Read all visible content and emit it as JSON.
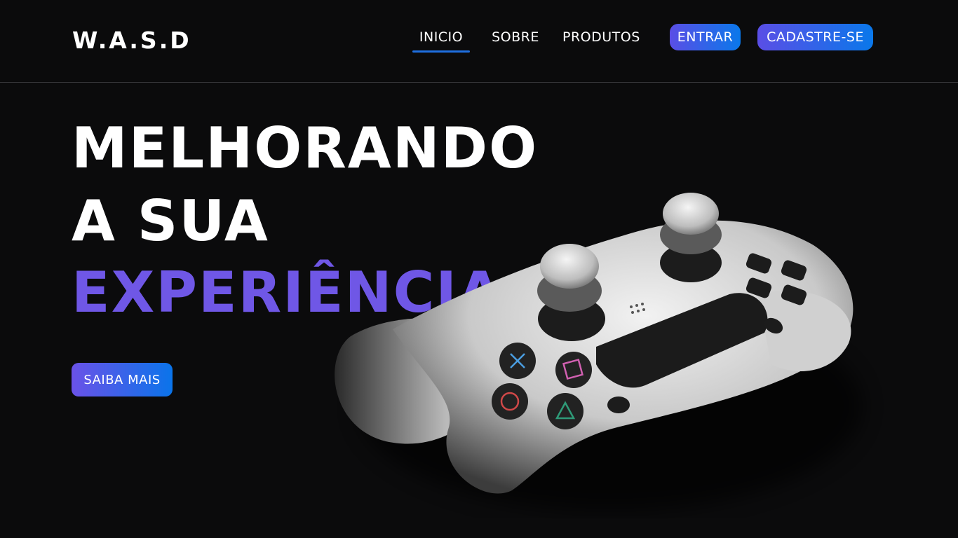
{
  "header": {
    "logo": "W.A.S.D",
    "nav": [
      {
        "label": "INICIO",
        "active": true
      },
      {
        "label": "SOBRE",
        "active": false
      },
      {
        "label": "PRODUTOS",
        "active": false
      }
    ],
    "login_label": "ENTRAR",
    "signup_label": "CADASTRE-SE"
  },
  "hero": {
    "line1": "MELHORANDO",
    "line2": "A SUA",
    "line3": "EXPERIÊNCIA",
    "cta_label": "SAIBA MAIS"
  },
  "colors": {
    "background": "#0b0b0c",
    "accent_purple": "#6f57e6",
    "accent_blue": "#0a78ea"
  },
  "icons": {
    "hero_image": "game-controller-icon"
  }
}
